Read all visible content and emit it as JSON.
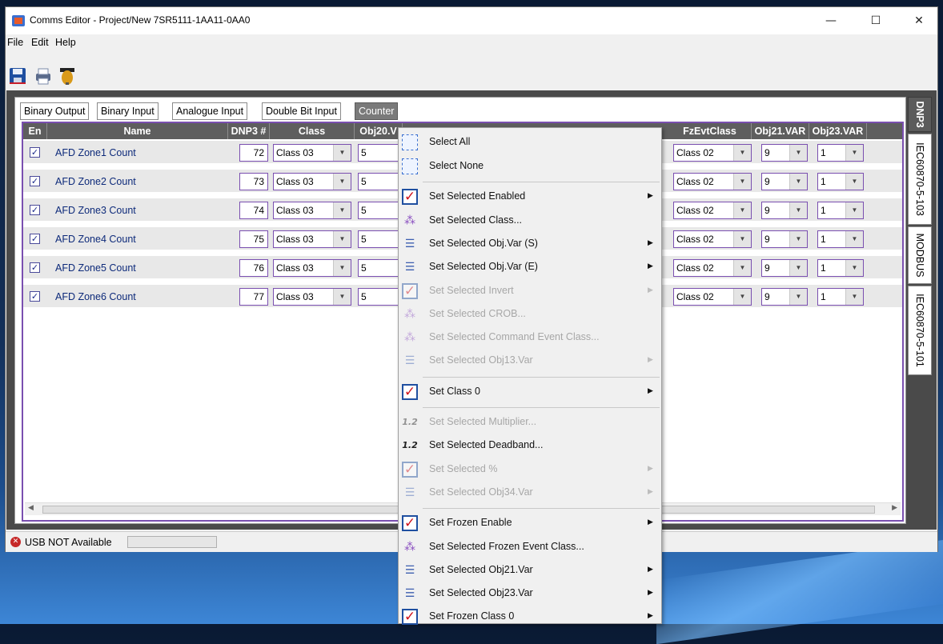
{
  "window": {
    "title": "Comms Editor - Project/New 7SR5111-1AA11-0AA0",
    "min_icon": "minimize-icon",
    "max_icon": "maximize-icon",
    "close_icon": "close-icon",
    "min_label": "—",
    "max_label": "☐",
    "close_label": "✕"
  },
  "menu": [
    "File",
    "Edit",
    "Help"
  ],
  "toolbar": [
    "save-icon",
    "print-icon",
    "help-icon"
  ],
  "tabs": [
    "Binary Output",
    "Binary Input",
    "Analogue Input",
    "Double Bit Input",
    "Counter"
  ],
  "active_tab": "Counter",
  "side_tabs": [
    "DNP3",
    "IEC60870-5-103",
    "MODBUS",
    "IEC60870-5-101"
  ],
  "active_side_tab": "DNP3",
  "grid": {
    "headers": [
      "En",
      "Name",
      "DNP3 #",
      "Class",
      "Obj20.V",
      "FzEvtClass",
      "Obj21.VAR",
      "Obj23.VAR"
    ],
    "rows": [
      {
        "en": "✓",
        "name": "AFD Zone1 Count",
        "dnp3": "72",
        "class": "Class 03",
        "obj20": "5",
        "fz": "Class 02",
        "obj21": "9",
        "obj23": "1"
      },
      {
        "en": "✓",
        "name": "AFD Zone2 Count",
        "dnp3": "73",
        "class": "Class 03",
        "obj20": "5",
        "fz": "Class 02",
        "obj21": "9",
        "obj23": "1"
      },
      {
        "en": "✓",
        "name": "AFD Zone3 Count",
        "dnp3": "74",
        "class": "Class 03",
        "obj20": "5",
        "fz": "Class 02",
        "obj21": "9",
        "obj23": "1"
      },
      {
        "en": "✓",
        "name": "AFD Zone4 Count",
        "dnp3": "75",
        "class": "Class 03",
        "obj20": "5",
        "fz": "Class 02",
        "obj21": "9",
        "obj23": "1"
      },
      {
        "en": "✓",
        "name": "AFD Zone5 Count",
        "dnp3": "76",
        "class": "Class 03",
        "obj20": "5",
        "fz": "Class 02",
        "obj21": "9",
        "obj23": "1"
      },
      {
        "en": "✓",
        "name": "AFD Zone6 Count",
        "dnp3": "77",
        "class": "Class 03",
        "obj20": "5",
        "fz": "Class 02",
        "obj21": "9",
        "obj23": "1"
      }
    ]
  },
  "status": {
    "icon": "error-icon",
    "text": "USB NOT Available"
  },
  "context_menu": [
    {
      "label": "Select All",
      "icon": "select-all-icon",
      "submenu": false,
      "disabled": false
    },
    {
      "label": "Select None",
      "icon": "select-none-icon",
      "submenu": false,
      "disabled": false
    },
    {
      "sep": true
    },
    {
      "label": "Set Selected Enabled",
      "icon": "check-icon",
      "submenu": true,
      "disabled": false
    },
    {
      "label": "Set Selected Class...",
      "icon": "class-icon",
      "submenu": false,
      "disabled": false
    },
    {
      "label": "Set Selected Obj.Var (S)",
      "icon": "list-icon",
      "submenu": true,
      "disabled": false
    },
    {
      "label": "Set Selected Obj.Var (E)",
      "icon": "list-icon",
      "submenu": true,
      "disabled": false
    },
    {
      "label": "Set Selected Invert",
      "icon": "check-icon",
      "submenu": true,
      "disabled": true
    },
    {
      "label": "Set Selected CROB...",
      "icon": "class-icon",
      "submenu": false,
      "disabled": true
    },
    {
      "label": "Set Selected Command Event Class...",
      "icon": "class-icon",
      "submenu": false,
      "disabled": true
    },
    {
      "label": "Set Selected Obj13.Var",
      "icon": "list-icon",
      "submenu": true,
      "disabled": true
    },
    {
      "sep": true
    },
    {
      "label": "Set Class 0",
      "icon": "check-icon",
      "submenu": true,
      "disabled": false
    },
    {
      "sep": true
    },
    {
      "label": "Set Selected Multiplier...",
      "icon": "number-icon",
      "submenu": false,
      "disabled": true
    },
    {
      "label": "Set Selected Deadband...",
      "icon": "number-icon",
      "submenu": false,
      "disabled": false
    },
    {
      "label": "Set Selected %",
      "icon": "check-icon",
      "submenu": true,
      "disabled": true
    },
    {
      "label": "Set Selected Obj34.Var",
      "icon": "list-icon",
      "submenu": true,
      "disabled": true
    },
    {
      "sep": true
    },
    {
      "label": "Set Frozen Enable",
      "icon": "check-icon",
      "submenu": true,
      "disabled": false
    },
    {
      "label": "Set Selected Frozen Event Class...",
      "icon": "class-icon",
      "submenu": false,
      "disabled": false
    },
    {
      "label": "Set Selected Obj21.Var",
      "icon": "list-icon",
      "submenu": true,
      "disabled": false
    },
    {
      "label": "Set Selected Obj23.Var",
      "icon": "list-icon",
      "submenu": true,
      "disabled": false
    },
    {
      "label": "Set Frozen Class 0",
      "icon": "check-icon",
      "submenu": true,
      "disabled": false
    }
  ],
  "colors": {
    "accent_border": "#7a4fb0",
    "header_bg": "#5e5e5e",
    "check_red": "#d0131b",
    "status_error": "#c62828"
  }
}
